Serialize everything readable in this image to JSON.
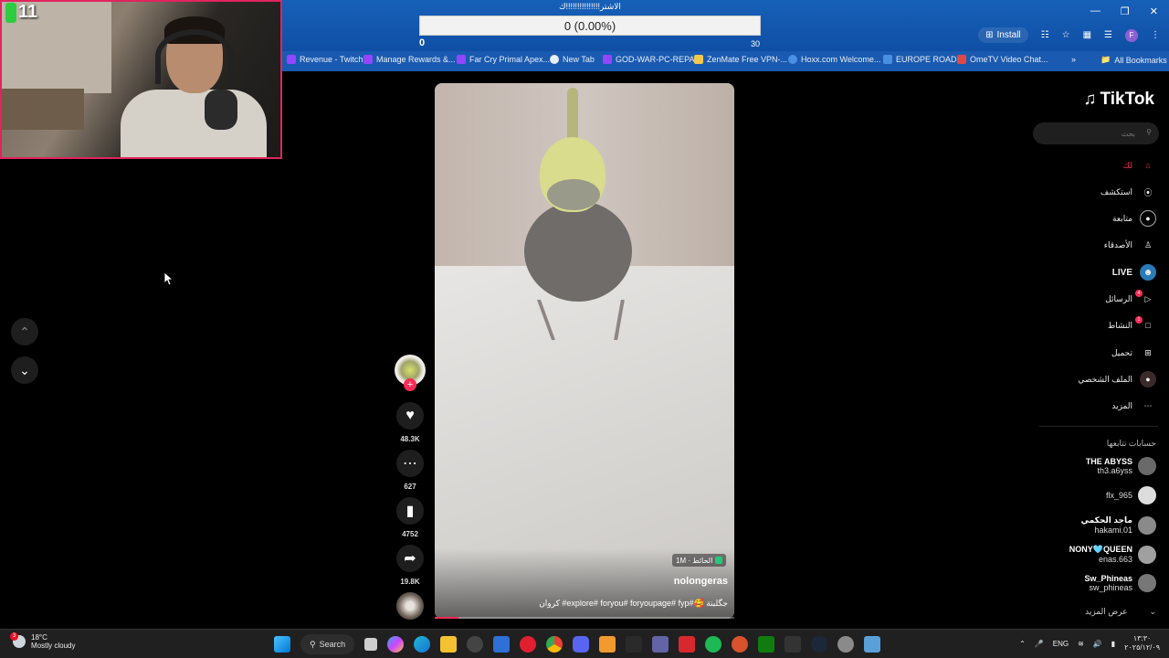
{
  "stream_overlay": {
    "cam_counter": "11",
    "goal_title": "الاشتر!!!!!!!!!!!!!!!ك",
    "goal_progress_text": "0 (0.00%)",
    "goal_min": "0",
    "goal_max": "30",
    "goal_fraction": 0.0
  },
  "browser": {
    "install_label": "Install",
    "profile_letter": "F",
    "bookmarks": [
      {
        "label": "Revenue - Twitch",
        "color": "#9146ff"
      },
      {
        "label": "Manage Rewards &...",
        "color": "#9146ff"
      },
      {
        "label": "Far Cry Primal Apex...",
        "color": "#9146ff"
      },
      {
        "label": "New Tab",
        "color": "#e8eef9"
      },
      {
        "label": "GOD-WAR-PC-REPA...",
        "color": "#9146ff"
      },
      {
        "label": "ZenMate Free VPN-...",
        "color": "#f2c94c"
      },
      {
        "label": "Hoxx.com Welcome...",
        "color": "#4a90e2"
      },
      {
        "label": "EUROPE ROADS",
        "color": "#4a90e2"
      },
      {
        "label": "OmeTV Video Chat...",
        "color": "#e04848"
      }
    ],
    "all_bookmarks_label": "All Bookmarks"
  },
  "tiktok": {
    "logo_text": "TikTok",
    "search_placeholder": "بحث",
    "nav": [
      {
        "label": "لك",
        "icon": "home-icon"
      },
      {
        "label": "استكشف",
        "icon": "compass-icon"
      },
      {
        "label": "متابعة",
        "icon": "following-icon"
      },
      {
        "label": "الأصدقاء",
        "icon": "friends-icon"
      },
      {
        "label": "LIVE",
        "icon": "live-icon"
      },
      {
        "label": "الرسائل",
        "icon": "messages-icon"
      },
      {
        "label": "النشاط",
        "icon": "activity-icon"
      },
      {
        "label": "تحميل",
        "icon": "upload-icon"
      },
      {
        "label": "الملف الشخصي",
        "icon": "profile-icon"
      },
      {
        "label": "المزيد",
        "icon": "more-icon"
      }
    ],
    "messages_badge": "4",
    "activity_badge": "1",
    "following_header": "حسابات تتابعها",
    "following_accounts": [
      {
        "name": "THE ABYSS",
        "handle": "th3.a6yss"
      },
      {
        "name": "",
        "handle": "flx_965"
      },
      {
        "name": "ماجد الحكمي",
        "handle": "hakami.01"
      },
      {
        "name": "NONY🩵QUEEN",
        "handle": "enas.663"
      },
      {
        "name": "Sw_Phineas",
        "handle": "sw_phineas"
      }
    ],
    "see_more_label": "عرض المزيد",
    "video": {
      "tag": "1M · الحائط",
      "author": "nolongeras",
      "caption": "كروان #explore# foryou# foryoupage# fyp#🥰 جگلبتة",
      "progress_fraction": 0.08
    },
    "actions": {
      "likes": "48.3K",
      "comments": "627",
      "saves": "4752",
      "shares": "19.8K"
    }
  },
  "taskbar": {
    "weather_badge": "3",
    "temperature": "18°C",
    "weather_text": "Mostly cloudy",
    "search_label": "Search",
    "language": "ENG",
    "time": "١٣:٣٠",
    "date": "٢٠٢٥/١٢/٠٩"
  }
}
